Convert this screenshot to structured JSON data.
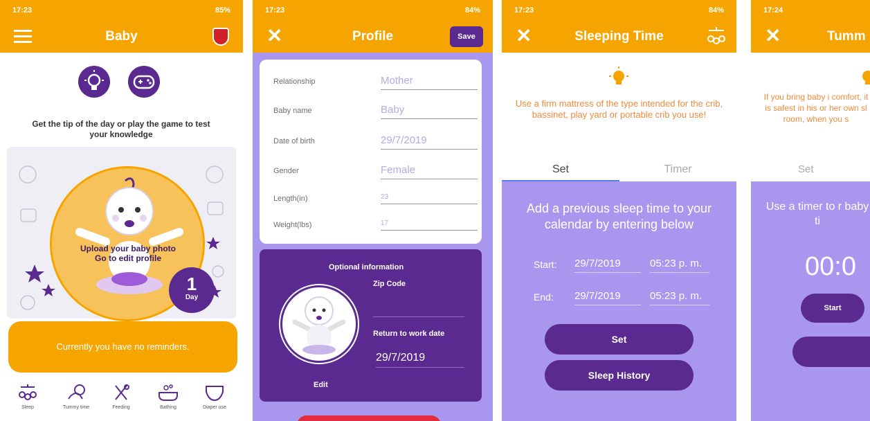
{
  "p1": {
    "status_left": "17:23",
    "status_right": "85%",
    "title": "Baby",
    "prompt": "Get the tip of the day or play the game to test your knowledge",
    "upload_line1": "Upload your baby photo",
    "upload_line2": "Go to edit profile",
    "day_number": "1",
    "day_label": "Day",
    "reminder": "Currently you have no reminders.",
    "nav": [
      "Sleep",
      "Tummy time",
      "Feeding",
      "Bathing",
      "Diaper use"
    ]
  },
  "p2": {
    "status_left": "17:23",
    "status_right": "84%",
    "title": "Profile",
    "save": "Save",
    "fields": [
      {
        "label": "Relationship",
        "value": "Mother"
      },
      {
        "label": "Baby name",
        "value": "Baby"
      },
      {
        "label": "Date of birth",
        "value": "29/7/2019"
      },
      {
        "label": "Gender",
        "value": "Female"
      },
      {
        "label": "Length(in)",
        "value": "23"
      },
      {
        "label": "Weight(lbs)",
        "value": "17"
      }
    ],
    "optional_title": "Optional information",
    "zip_label": "Zip Code",
    "return_label": "Return to work date",
    "return_value": "29/7/2019",
    "edit": "Edit"
  },
  "p3": {
    "status_left": "17:23",
    "status_right": "84%",
    "title": "Sleeping Time",
    "tip": "Use a firm mattress of the type intended for the crib, bassinet, play yard or portable crib you use!",
    "tab_set": "Set",
    "tab_timer": "Timer",
    "instructions": "Add a previous sleep time to your calendar by entering below",
    "start_label": "Start:",
    "start_date": "29/7/2019",
    "start_time": "05:23 p. m.",
    "end_label": "End:",
    "end_date": "29/7/2019",
    "end_time": "05:23 p. m.",
    "set_button": "Set",
    "history_button": "Sleep History"
  },
  "p4": {
    "status_left": "17:24",
    "title": "Tumm",
    "tip": "If you bring baby i comfort, it is safest in his or her own sl room, when you s",
    "tab_set": "Set",
    "instructions": "Use a timer to r baby ti",
    "timer": "00:0",
    "start_button": "Start"
  },
  "colors": {
    "orange": "#f5a400",
    "purple": "#5a2a90",
    "lavender": "#a996ef"
  }
}
